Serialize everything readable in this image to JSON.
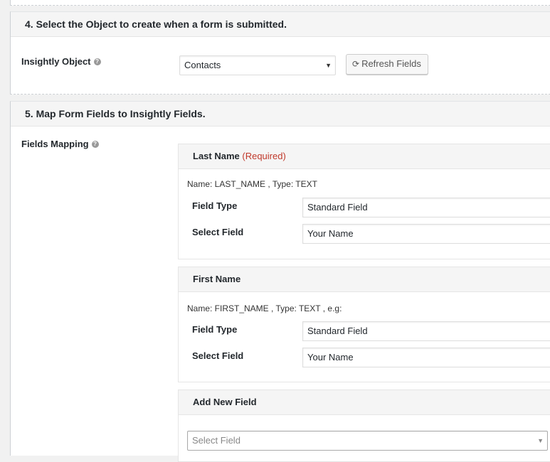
{
  "section4": {
    "heading": "4. Select the Object to create when a form is submitted.",
    "object_label": "Insightly Object",
    "object_value": "Contacts",
    "refresh_button": "Refresh Fields"
  },
  "section5": {
    "heading": "5. Map Form Fields to Insightly Fields.",
    "mapping_label": "Fields Mapping",
    "cards": [
      {
        "title": "Last Name",
        "required": "(Required)",
        "meta": "Name: LAST_NAME , Type: TEXT",
        "field_type_label": "Field Type",
        "field_type_value": "Standard Field",
        "select_field_label": "Select Field",
        "select_field_value": "Your Name"
      },
      {
        "title": "First Name",
        "meta": "Name: FIRST_NAME , Type: TEXT , e.g:",
        "field_type_label": "Field Type",
        "field_type_value": "Standard Field",
        "select_field_label": "Select Field",
        "select_field_value": "Your Name"
      }
    ],
    "add_new": {
      "title": "Add New Field",
      "placeholder": "Select Field"
    }
  },
  "colors": {
    "required_text": "#c0392b",
    "panel_header_bg": "#f5f5f5",
    "page_bg": "#f1f1f1"
  }
}
